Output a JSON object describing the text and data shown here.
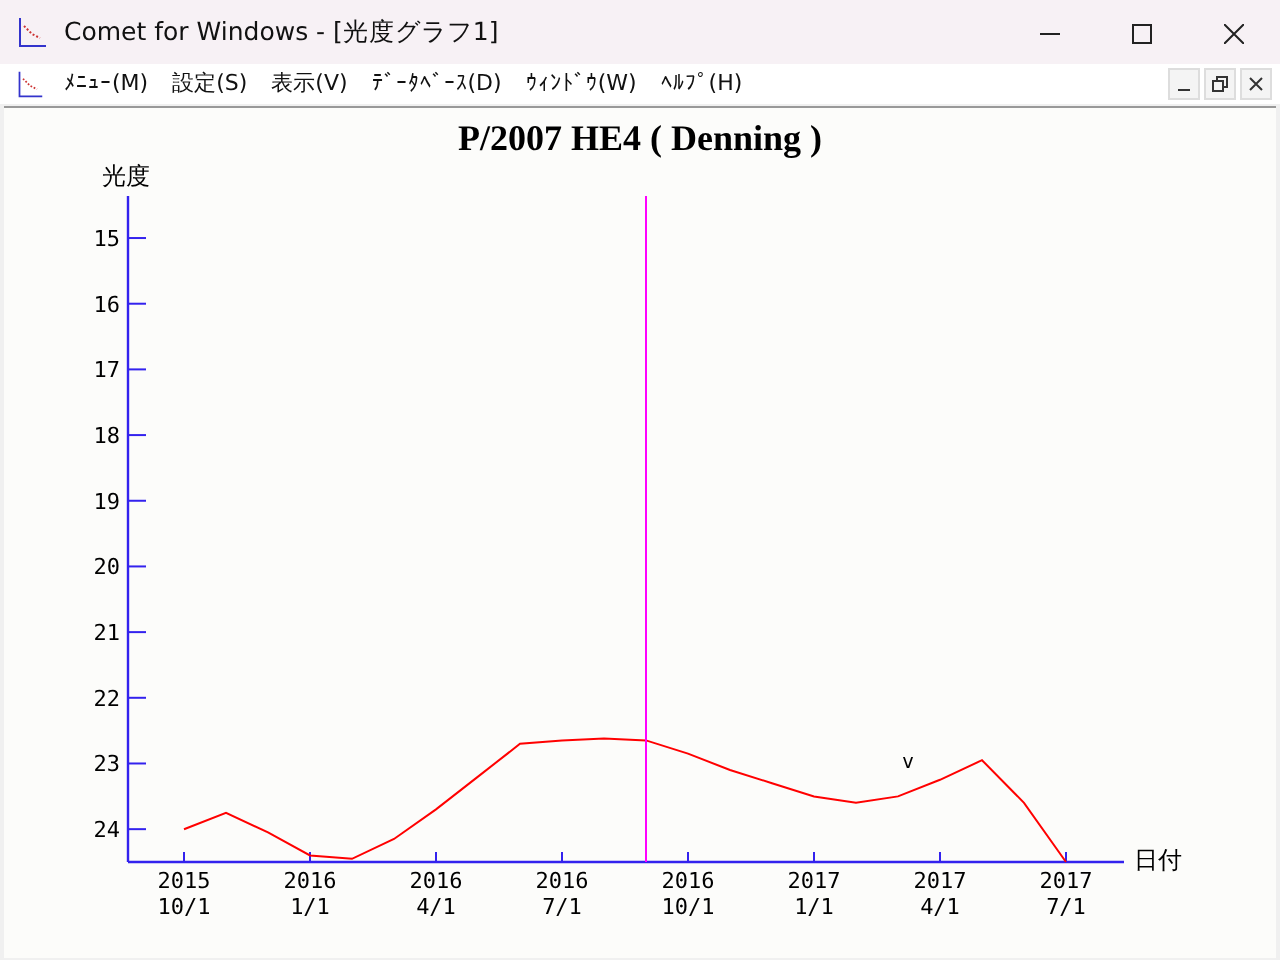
{
  "window": {
    "title": "Comet for Windows - [光度グラフ1]"
  },
  "menu": [
    {
      "label": "ﾒﾆｭｰ(M)"
    },
    {
      "label": "設定(S)"
    },
    {
      "label": "表示(V)"
    },
    {
      "label": "ﾃﾞｰﾀﾍﾞｰｽ(D)"
    },
    {
      "label": "ｳｨﾝﾄﾞｳ(W)"
    },
    {
      "label": "ﾍﾙﾌﾟ(H)"
    }
  ],
  "chart": {
    "chart_data": {
      "type": "line",
      "title": "P/2007 HE4 ( Denning )",
      "xlabel": "日付",
      "ylabel": "光度",
      "ylim": [
        24.5,
        14.36
      ],
      "yticks": [
        15,
        16,
        17,
        18,
        19,
        20,
        21,
        22,
        23,
        24
      ],
      "categories": [
        "2015 10/1",
        null,
        null,
        "2016 1/1",
        null,
        null,
        "2016 4/1",
        null,
        null,
        "2016 7/1",
        null,
        null,
        "2016 10/1",
        null,
        null,
        "2017 1/1",
        null,
        null,
        "2017 4/1",
        null,
        null,
        "2017 7/1"
      ],
      "series": [
        {
          "color": "#ff0000",
          "values": [
            24.0,
            23.75,
            24.05,
            24.4,
            24.45,
            24.15,
            23.7,
            23.2,
            22.7,
            22.65,
            22.62,
            22.65,
            22.85,
            23.1,
            23.3,
            23.5,
            23.6,
            23.5,
            23.25,
            22.95,
            23.6,
            24.5
          ]
        }
      ],
      "annotations": [
        "v"
      ]
    }
  }
}
